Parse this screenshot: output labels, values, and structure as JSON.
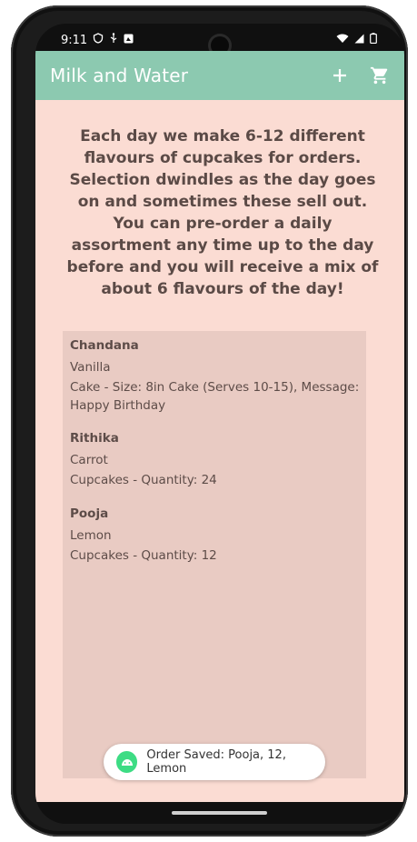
{
  "status_bar": {
    "time": "9:11"
  },
  "app_bar": {
    "title": "Milk and Water",
    "add_icon": "plus-icon",
    "cart_icon": "cart-icon"
  },
  "intro_text": "Each day we make 6-12 different flavours of cupcakes for orders. Selection dwindles as the day goes on and sometimes these sell out. You can pre-order a daily assortment any time up to the day before and you will receive a mix of about 6 flavours of the day!",
  "orders": [
    {
      "name": "Chandana",
      "flavour": "Vanilla",
      "details": "Cake - Size: 8in Cake (Serves 10-15), Message: Happy Birthday"
    },
    {
      "name": "Rithika",
      "flavour": "Carrot",
      "details": "Cupcakes - Quantity: 24"
    },
    {
      "name": "Pooja",
      "flavour": "Lemon",
      "details": "Cupcakes - Quantity: 12"
    }
  ],
  "toast": {
    "text": "Order Saved: Pooja, 12, Lemon",
    "icon": "android-icon"
  },
  "colors": {
    "appbar": "#8cc9b0",
    "background": "#fbdcd3",
    "orders_panel": "#e9cbc3"
  }
}
